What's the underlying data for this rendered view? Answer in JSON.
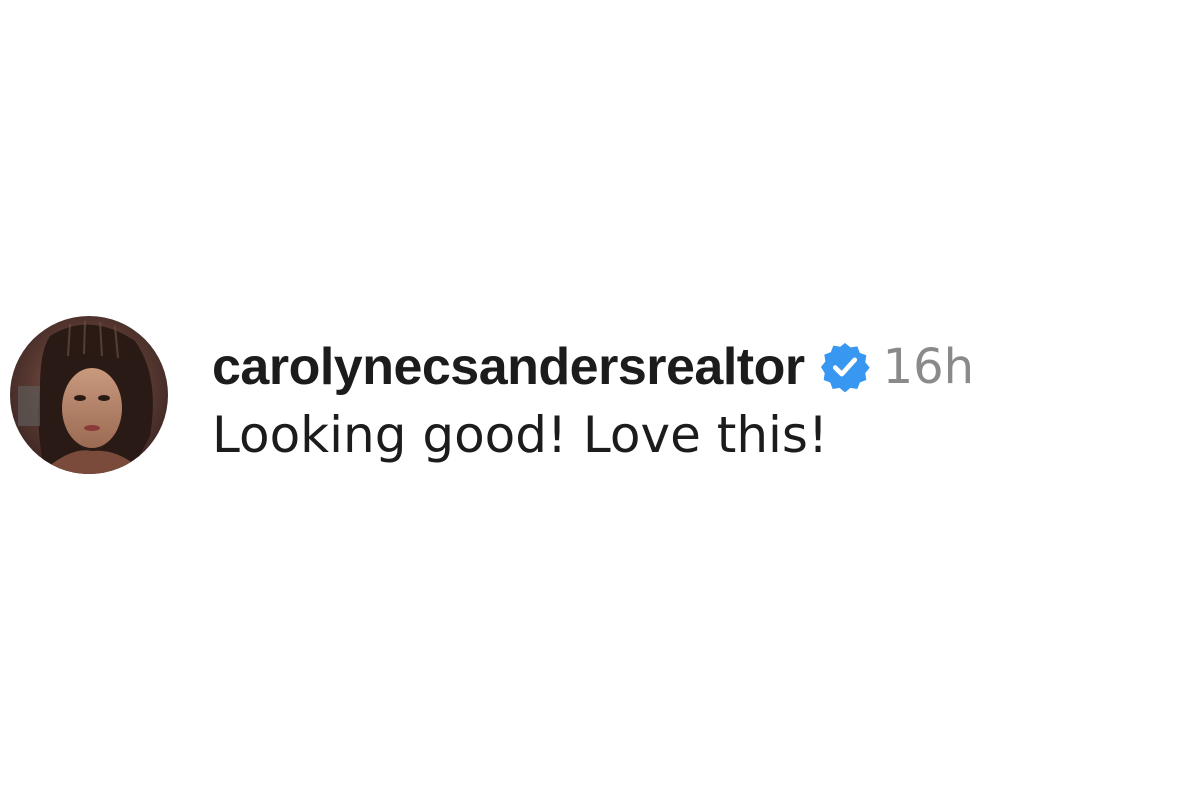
{
  "comment": {
    "avatar": {
      "icon": "profile-photo",
      "alt": ""
    },
    "username": "carolynecsandersrealtor",
    "verified": {
      "icon": "verified-badge-icon",
      "color": "#3897f0"
    },
    "timestamp": "16h",
    "text": "Looking good! Love this!"
  }
}
